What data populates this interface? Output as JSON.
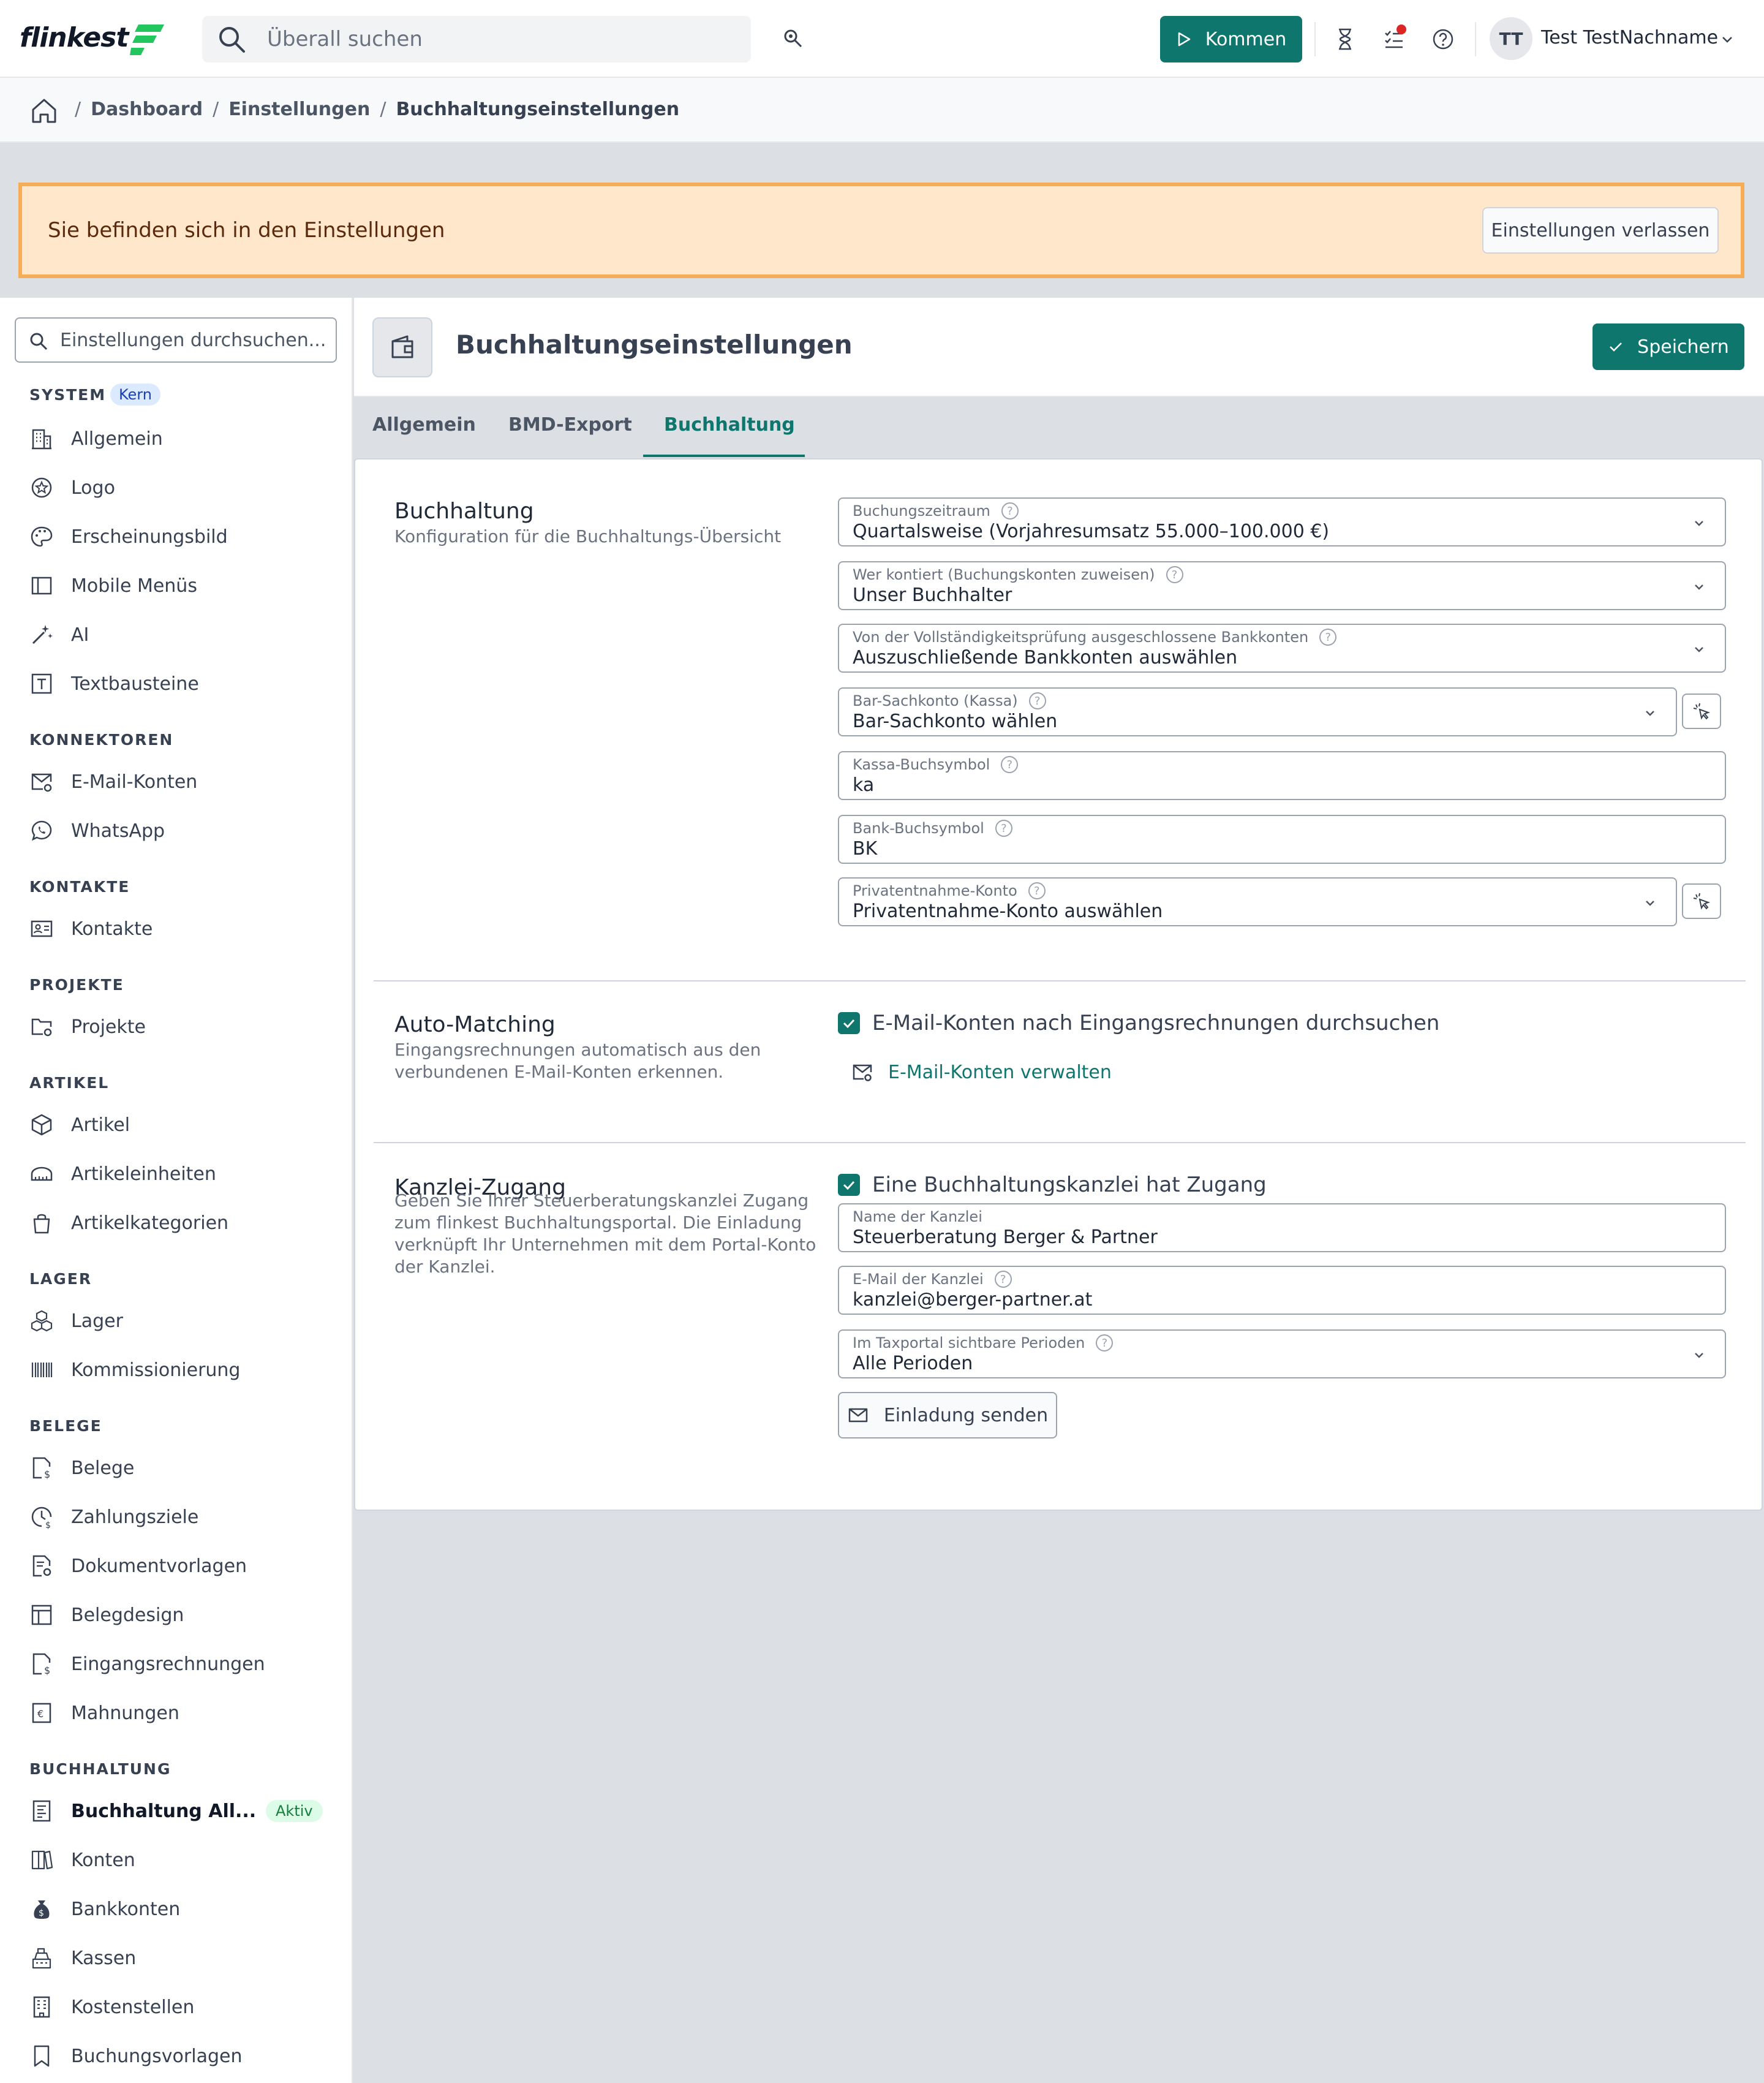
{
  "app": {
    "logo_text": "flinkest"
  },
  "topbar": {
    "search_placeholder": "Überall suchen",
    "kommen_label": "Kommen",
    "avatar_initials": "TT",
    "user_name": "Test TestNachname"
  },
  "breadcrumb": {
    "items": [
      "Dashboard",
      "Einstellungen",
      "Buchhaltungseinstellungen"
    ],
    "separator": "/"
  },
  "banner": {
    "text": "Sie befinden sich in den Einstellungen",
    "button": "Einstellungen verlassen"
  },
  "sidebar": {
    "search_placeholder": "Einstellungen durchsuchen...",
    "sections": [
      {
        "title": "SYSTEM",
        "tag": "Kern",
        "items": [
          {
            "label": "Allgemein",
            "icon": "building-icon"
          },
          {
            "label": "Logo",
            "icon": "badge-icon"
          },
          {
            "label": "Erscheinungsbild",
            "icon": "palette-icon"
          },
          {
            "label": "Mobile Menüs",
            "icon": "layout-sidebar-icon"
          },
          {
            "label": "AI",
            "icon": "sparkles-icon"
          },
          {
            "label": "Textbausteine",
            "icon": "text-box-icon"
          }
        ]
      },
      {
        "title": "KONNEKTOREN",
        "items": [
          {
            "label": "E-Mail-Konten",
            "icon": "mail-settings-icon"
          },
          {
            "label": "WhatsApp",
            "icon": "whatsapp-icon"
          }
        ]
      },
      {
        "title": "KONTAKTE",
        "items": [
          {
            "label": "Kontakte",
            "icon": "contact-card-icon"
          }
        ]
      },
      {
        "title": "PROJEKTE",
        "items": [
          {
            "label": "Projekte",
            "icon": "folder-settings-icon"
          }
        ]
      },
      {
        "title": "ARTIKEL",
        "items": [
          {
            "label": "Artikel",
            "icon": "box-icon"
          },
          {
            "label": "Artikeleinheiten",
            "icon": "ruler-icon"
          },
          {
            "label": "Artikelkategorien",
            "icon": "shopping-bag-icon"
          }
        ]
      },
      {
        "title": "LAGER",
        "items": [
          {
            "label": "Lager",
            "icon": "boxes-icon"
          },
          {
            "label": "Kommissionierung",
            "icon": "barcode-icon"
          }
        ]
      },
      {
        "title": "BELEGE",
        "items": [
          {
            "label": "Belege",
            "icon": "receipt-dollar-icon"
          },
          {
            "label": "Zahlungsziele",
            "icon": "clock-dollar-icon"
          },
          {
            "label": "Dokumentvorlagen",
            "icon": "document-settings-icon"
          },
          {
            "label": "Belegdesign",
            "icon": "layout-icon"
          },
          {
            "label": "Eingangsrechnungen",
            "icon": "invoice-in-icon"
          },
          {
            "label": "Mahnungen",
            "icon": "euro-note-icon"
          }
        ]
      },
      {
        "title": "BUCHHALTUNG",
        "items": [
          {
            "label": "Buchhaltung All...",
            "icon": "ledger-icon",
            "active": true,
            "badge": "Aktiv"
          },
          {
            "label": "Konten",
            "icon": "books-icon"
          },
          {
            "label": "Bankkonten",
            "icon": "money-bag-icon"
          },
          {
            "label": "Kassen",
            "icon": "cash-register-icon"
          },
          {
            "label": "Kostenstellen",
            "icon": "building-columns-icon"
          },
          {
            "label": "Buchungsvorlagen",
            "icon": "bookmark-icon"
          }
        ]
      }
    ]
  },
  "page": {
    "title": "Buchhaltungseinstellungen",
    "save_label": "Speichern"
  },
  "tabs": [
    "Allgemein",
    "BMD-Export",
    "Buchhaltung"
  ],
  "active_tab": "Buchhaltung",
  "sections": {
    "buchhaltung": {
      "title": "Buchhaltung",
      "description": "Konfiguration für die Buchhaltungs-Übersicht",
      "fields": [
        {
          "label": "Buchungszeitraum",
          "value": "Quartalsweise (Vorjahresumsatz 55.000–100.000 €)",
          "type": "select"
        },
        {
          "label": "Wer kontiert (Buchungskonten zuweisen)",
          "value": "Unser Buchhalter",
          "type": "select"
        },
        {
          "label": "Von der Vollständigkeitsprüfung ausgeschlossene Bankkonten",
          "value": "Auszuschließende Bankkonten auswählen",
          "type": "select"
        },
        {
          "label": "Bar-Sachkonto (Kassa)",
          "value": "Bar-Sachkonto wählen",
          "type": "select-pick"
        },
        {
          "label": "Kassa-Buchsymbol",
          "value": "ka",
          "type": "text"
        },
        {
          "label": "Bank-Buchsymbol",
          "value": "BK",
          "type": "text"
        },
        {
          "label": "Privatentnahme-Konto",
          "value": "Privatentnahme-Konto auswählen",
          "type": "select-pick"
        }
      ]
    },
    "auto_matching": {
      "title": "Auto-Matching",
      "description": "Eingangsrechnungen automatisch aus den verbundenen E-Mail-Konten erkennen.",
      "checkbox_label": "E-Mail-Konten nach Eingangsrechnungen durchsuchen",
      "checked": true,
      "link_label": "E-Mail-Konten verwalten"
    },
    "kanzlei": {
      "title": "Kanzlei-Zugang",
      "description": "Geben Sie Ihrer Steuerberatungskanzlei Zugang zum flinkest Buchhaltungsportal. Die Einladung verknüpft Ihr Unternehmen mit dem Portal-Konto der Kanzlei.",
      "checkbox_label": "Eine Buchhaltungskanzlei hat Zugang",
      "checked": true,
      "fields": [
        {
          "label": "Name der Kanzlei",
          "value": "Steuerberatung Berger & Partner"
        },
        {
          "label": "E-Mail der Kanzlei",
          "value": "kanzlei@berger-partner.at"
        },
        {
          "label": "Im Taxportal sichtbare Perioden",
          "value": "Alle Perioden"
        }
      ],
      "invite_label": "Einladung senden"
    }
  },
  "colors": {
    "accent": "#0f766e",
    "banner_bg": "#ffe7cc",
    "banner_border": "#f6ad55",
    "notification_dot": "#dc2626"
  }
}
